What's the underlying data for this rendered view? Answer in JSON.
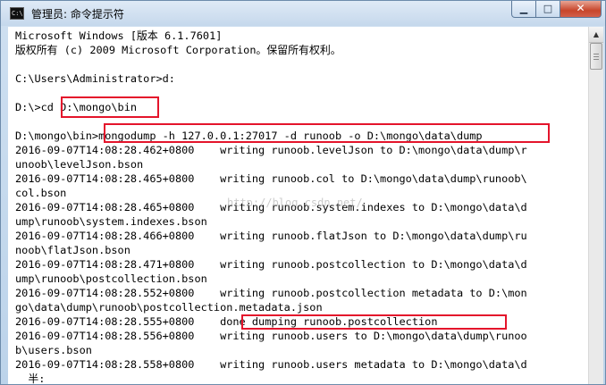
{
  "window": {
    "title": "管理员: 命令提示符",
    "icon_text": "C:\\",
    "buttons": {
      "minimize": "▁",
      "maximize": "□",
      "close": "✕"
    }
  },
  "console": {
    "lines": [
      "Microsoft Windows [版本 6.1.7601]",
      "版权所有 (c) 2009 Microsoft Corporation。保留所有权利。",
      "",
      "C:\\Users\\Administrator>d:",
      "",
      "D:\\>cd D:\\mongo\\bin",
      "",
      "D:\\mongo\\bin>mongodump -h 127.0.0.1:27017 -d runoob -o D:\\mongo\\data\\dump",
      "2016-09-07T14:08:28.462+0800    writing runoob.levelJson to D:\\mongo\\data\\dump\\r",
      "unoob\\levelJson.bson",
      "2016-09-07T14:08:28.465+0800    writing runoob.col to D:\\mongo\\data\\dump\\runoob\\",
      "col.bson",
      "2016-09-07T14:08:28.465+0800    writing runoob.system.indexes to D:\\mongo\\data\\d",
      "ump\\runoob\\system.indexes.bson",
      "2016-09-07T14:08:28.466+0800    writing runoob.flatJson to D:\\mongo\\data\\dump\\ru",
      "noob\\flatJson.bson",
      "2016-09-07T14:08:28.471+0800    writing runoob.postcollection to D:\\mongo\\data\\d",
      "ump\\runoob\\postcollection.bson",
      "2016-09-07T14:08:28.552+0800    writing runoob.postcollection metadata to D:\\mon",
      "go\\data\\dump\\runoob\\postcollection.metadata.json",
      "2016-09-07T14:08:28.555+0800    done dumping runoob.postcollection",
      "2016-09-07T14:08:28.556+0800    writing runoob.users to D:\\mongo\\data\\dump\\runoo",
      "b\\users.bson",
      "2016-09-07T14:08:28.558+0800    writing runoob.users metadata to D:\\mongo\\data\\d",
      "  半:"
    ]
  },
  "watermark": "http://blog.csdn.net/",
  "colors": {
    "highlight": "#e4142b",
    "console_bg": "#ffffff",
    "console_text": "#000000"
  }
}
